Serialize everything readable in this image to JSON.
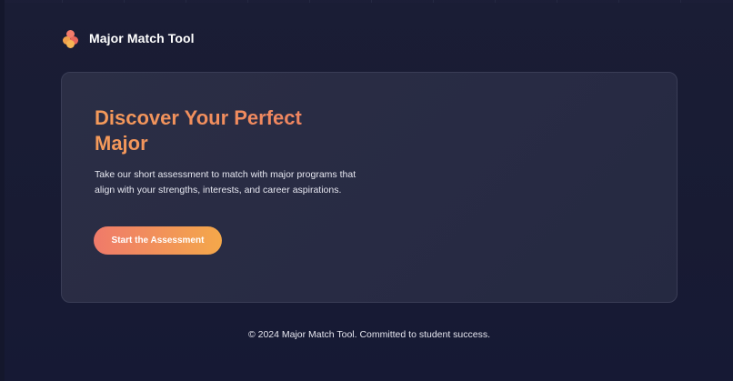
{
  "header": {
    "brand": "Major Match Tool",
    "logo_icon": "dots-logo-icon"
  },
  "hero": {
    "title": "Discover Your Perfect Major",
    "description": "Take our short assessment to match with major programs that align with your strengths, interests, and career aspirations.",
    "cta_label": "Start the Assessment"
  },
  "footer": {
    "text": "© 2024 Major Match Tool. Committed to student success."
  },
  "colors": {
    "background": "#1a1d35",
    "card": "#2b2e45",
    "accent_start": "#ef7a6a",
    "accent_end": "#f4a84a",
    "title": "#f49a5a"
  }
}
